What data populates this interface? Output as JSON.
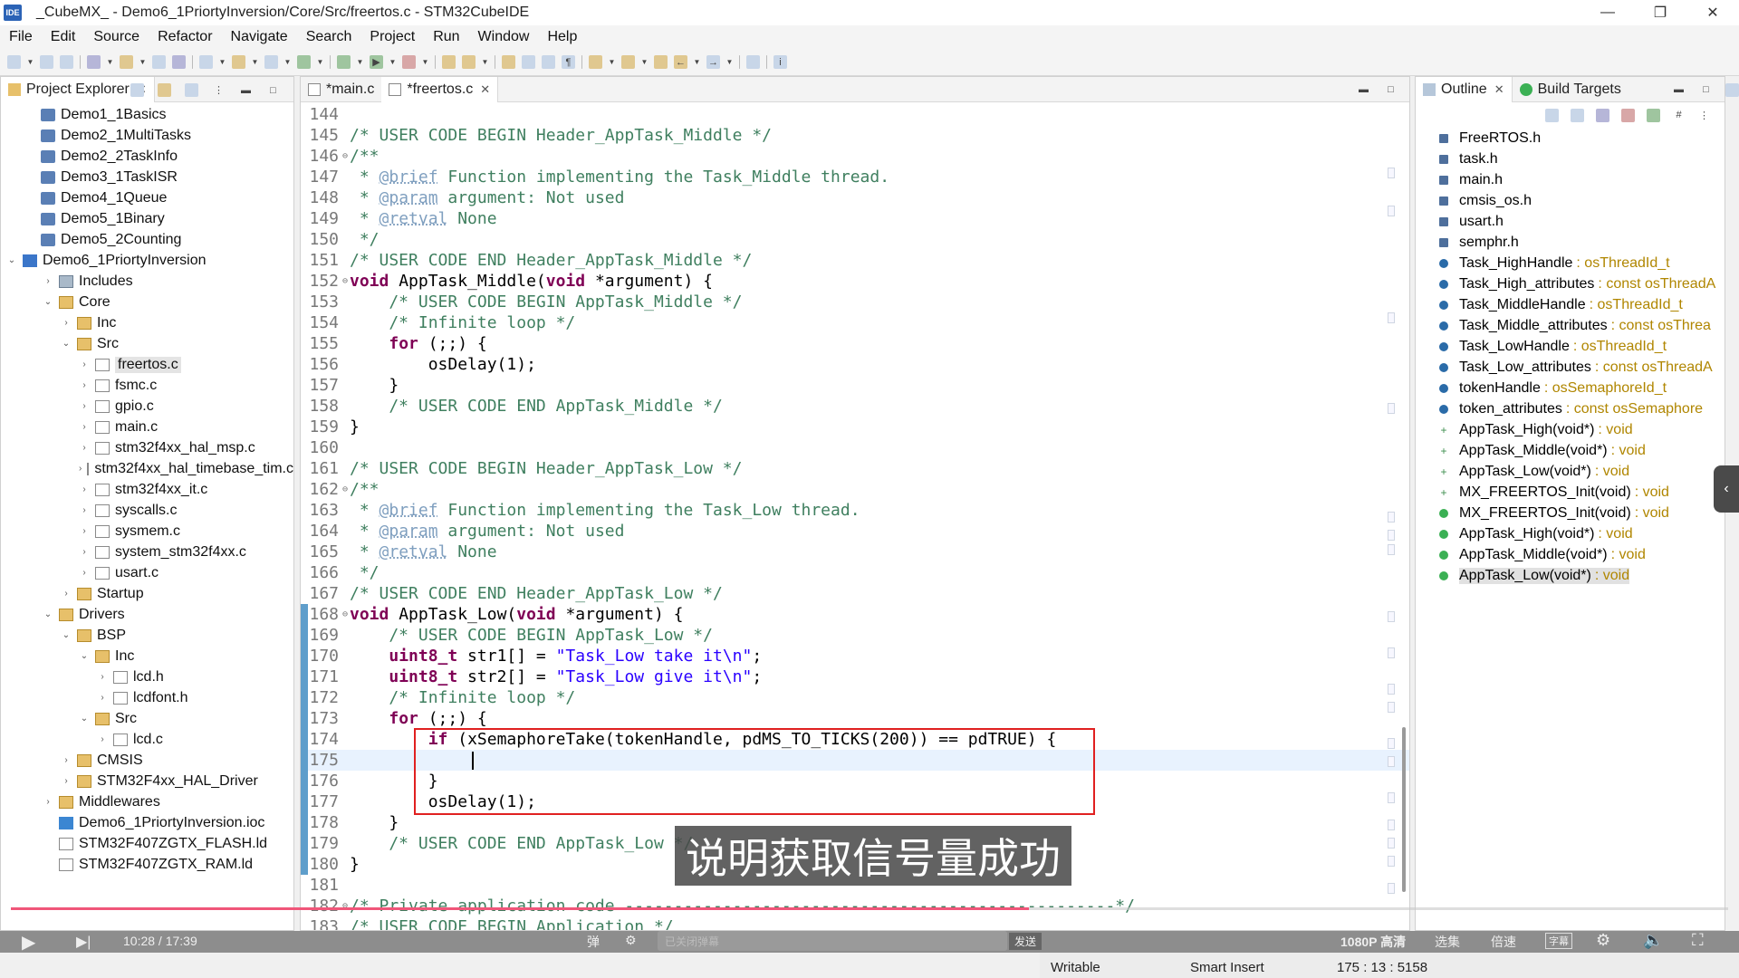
{
  "window": {
    "title": "_CubeMX_ - Demo6_1PriortyInversion/Core/Src/freertos.c - STM32CubeIDE",
    "app_icon_text": "IDE"
  },
  "menu": [
    "File",
    "Edit",
    "Source",
    "Refactor",
    "Navigate",
    "Search",
    "Project",
    "Run",
    "Window",
    "Help"
  ],
  "explorer": {
    "title": "Project Explorer",
    "items": [
      {
        "label": "Demo1_1Basics",
        "icon": "project-icon"
      },
      {
        "label": "Demo2_1MultiTasks",
        "icon": "project-icon"
      },
      {
        "label": "Demo2_2TaskInfo",
        "icon": "project-icon"
      },
      {
        "label": "Demo3_1TaskISR",
        "icon": "project-icon"
      },
      {
        "label": "Demo4_1Queue",
        "icon": "project-icon"
      },
      {
        "label": "Demo5_1Binary",
        "icon": "project-icon"
      },
      {
        "label": "Demo5_2Counting",
        "icon": "project-icon"
      },
      {
        "label": "Demo6_1PriortyInversion",
        "icon": "ide-project-icon",
        "arrow": "⌄"
      },
      {
        "label": "Includes",
        "icon": "includes-icon",
        "arrow": "›"
      },
      {
        "label": "Core",
        "icon": "folder-icon",
        "arrow": "⌄"
      },
      {
        "label": "Inc",
        "icon": "folder-icon",
        "arrow": "›"
      },
      {
        "label": "Src",
        "icon": "folder-icon",
        "arrow": "⌄"
      },
      {
        "label": "freertos.c",
        "icon": "c-file-icon",
        "arrow": "›"
      },
      {
        "label": "fsmc.c",
        "icon": "c-file-icon",
        "arrow": "›"
      },
      {
        "label": "gpio.c",
        "icon": "c-file-icon",
        "arrow": "›"
      },
      {
        "label": "main.c",
        "icon": "c-file-icon",
        "arrow": "›"
      },
      {
        "label": "stm32f4xx_hal_msp.c",
        "icon": "c-file-icon",
        "arrow": "›"
      },
      {
        "label": "stm32f4xx_hal_timebase_tim.c",
        "icon": "c-file-icon",
        "arrow": "›"
      },
      {
        "label": "stm32f4xx_it.c",
        "icon": "c-file-icon",
        "arrow": "›"
      },
      {
        "label": "syscalls.c",
        "icon": "c-file-icon",
        "arrow": "›"
      },
      {
        "label": "sysmem.c",
        "icon": "c-file-icon",
        "arrow": "›"
      },
      {
        "label": "system_stm32f4xx.c",
        "icon": "c-file-icon",
        "arrow": "›"
      },
      {
        "label": "usart.c",
        "icon": "c-file-icon",
        "arrow": "›"
      },
      {
        "label": "Startup",
        "icon": "folder-icon",
        "arrow": "›"
      },
      {
        "label": "Drivers",
        "icon": "folder-icon",
        "arrow": "⌄"
      },
      {
        "label": "BSP",
        "icon": "folder-icon",
        "arrow": "⌄"
      },
      {
        "label": "Inc",
        "icon": "folder-icon",
        "arrow": "⌄"
      },
      {
        "label": "lcd.h",
        "icon": "h-file-icon",
        "arrow": "›"
      },
      {
        "label": "lcdfont.h",
        "icon": "h-file-icon",
        "arrow": "›"
      },
      {
        "label": "Src",
        "icon": "folder-icon",
        "arrow": "⌄"
      },
      {
        "label": "lcd.c",
        "icon": "c-file-icon",
        "arrow": "›"
      },
      {
        "label": "CMSIS",
        "icon": "folder-icon",
        "arrow": "›"
      },
      {
        "label": "STM32F4xx_HAL_Driver",
        "icon": "folder-icon",
        "arrow": "›"
      },
      {
        "label": "Middlewares",
        "icon": "folder-icon",
        "arrow": "›"
      },
      {
        "label": "Demo6_1PriortyInversion.ioc",
        "icon": "mx-file-icon"
      },
      {
        "label": "STM32F407ZGTX_FLASH.ld",
        "icon": "ld-file-icon"
      },
      {
        "label": "STM32F407ZGTX_RAM.ld",
        "icon": "ld-file-icon"
      }
    ]
  },
  "editor": {
    "tabs": [
      "*main.c",
      "*freertos.c"
    ],
    "lines": [
      {
        "n": "144",
        "t": ""
      },
      {
        "n": "145",
        "t": "/* USER CODE BEGIN Header_AppTask_Middle */"
      },
      {
        "n": "146",
        "t": "/**"
      },
      {
        "n": "147",
        "t": " * @brief Function implementing the Task_Middle thread."
      },
      {
        "n": "148",
        "t": " * @param argument: Not used"
      },
      {
        "n": "149",
        "t": " * @retval None"
      },
      {
        "n": "150",
        "t": " */"
      },
      {
        "n": "151",
        "t": "/* USER CODE END Header_AppTask_Middle */"
      },
      {
        "n": "152",
        "t": "void AppTask_Middle(void *argument) {"
      },
      {
        "n": "153",
        "t": "    /* USER CODE BEGIN AppTask_Middle */"
      },
      {
        "n": "154",
        "t": "    /* Infinite loop */"
      },
      {
        "n": "155",
        "t": "    for (;;) {"
      },
      {
        "n": "156",
        "t": "        osDelay(1);"
      },
      {
        "n": "157",
        "t": "    }"
      },
      {
        "n": "158",
        "t": "    /* USER CODE END AppTask_Middle */"
      },
      {
        "n": "159",
        "t": "}"
      },
      {
        "n": "160",
        "t": ""
      },
      {
        "n": "161",
        "t": "/* USER CODE BEGIN Header_AppTask_Low */"
      },
      {
        "n": "162",
        "t": "/**"
      },
      {
        "n": "163",
        "t": " * @brief Function implementing the Task_Low thread."
      },
      {
        "n": "164",
        "t": " * @param argument: Not used"
      },
      {
        "n": "165",
        "t": " * @retval None"
      },
      {
        "n": "166",
        "t": " */"
      },
      {
        "n": "167",
        "t": "/* USER CODE END Header_AppTask_Low */"
      },
      {
        "n": "168",
        "t": "void AppTask_Low(void *argument) {"
      },
      {
        "n": "169",
        "t": "    /* USER CODE BEGIN AppTask_Low */"
      },
      {
        "n": "170",
        "t": "    uint8_t str1[] = \"Task_Low take it\\n\";"
      },
      {
        "n": "171",
        "t": "    uint8_t str2[] = \"Task_Low give it\\n\";"
      },
      {
        "n": "172",
        "t": "    /* Infinite loop */"
      },
      {
        "n": "173",
        "t": "    for (;;) {"
      },
      {
        "n": "174",
        "t": "        if (xSemaphoreTake(tokenHandle, pdMS_TO_TICKS(200)) == pdTRUE) {"
      },
      {
        "n": "175",
        "t": "            "
      },
      {
        "n": "176",
        "t": "        }"
      },
      {
        "n": "177",
        "t": "        osDelay(1);"
      },
      {
        "n": "178",
        "t": "    }"
      },
      {
        "n": "179",
        "t": "    /* USER CODE END AppTask_Low */"
      },
      {
        "n": "180",
        "t": "}"
      },
      {
        "n": "181",
        "t": ""
      },
      {
        "n": "182",
        "t": "/* Private application code --------------------------------------------------*/"
      },
      {
        "n": "183",
        "t": "/* USER CODE BEGIN Application */"
      }
    ]
  },
  "outline": {
    "tabs": [
      "Outline",
      "Build Targets"
    ],
    "items": [
      {
        "name": "FreeRTOS.h",
        "type": "",
        "kind": "include"
      },
      {
        "name": "task.h",
        "type": "",
        "kind": "include"
      },
      {
        "name": "main.h",
        "type": "",
        "kind": "include"
      },
      {
        "name": "cmsis_os.h",
        "type": "",
        "kind": "include"
      },
      {
        "name": "usart.h",
        "type": "",
        "kind": "include"
      },
      {
        "name": "semphr.h",
        "type": "",
        "kind": "include"
      },
      {
        "name": "Task_HighHandle",
        "type": ": osThreadId_t",
        "kind": "var"
      },
      {
        "name": "Task_High_attributes",
        "type": ": const osThreadA",
        "kind": "var"
      },
      {
        "name": "Task_MiddleHandle",
        "type": ": osThreadId_t",
        "kind": "var"
      },
      {
        "name": "Task_Middle_attributes",
        "type": ": const osThrea",
        "kind": "var"
      },
      {
        "name": "Task_LowHandle",
        "type": ": osThreadId_t",
        "kind": "var"
      },
      {
        "name": "Task_Low_attributes",
        "type": ": const osThreadA",
        "kind": "var"
      },
      {
        "name": "tokenHandle",
        "type": ": osSemaphoreId_t",
        "kind": "var"
      },
      {
        "name": "token_attributes",
        "type": ": const osSemaphore",
        "kind": "var"
      },
      {
        "name": "AppTask_High(void*)",
        "type": ": void",
        "kind": "decl"
      },
      {
        "name": "AppTask_Middle(void*)",
        "type": ": void",
        "kind": "decl"
      },
      {
        "name": "AppTask_Low(void*)",
        "type": ": void",
        "kind": "decl"
      },
      {
        "name": "MX_FREERTOS_Init(void)",
        "type": ": void",
        "kind": "decl"
      },
      {
        "name": "MX_FREERTOS_Init(void)",
        "type": ": void",
        "kind": "fn"
      },
      {
        "name": "AppTask_High(void*)",
        "type": ": void",
        "kind": "fn"
      },
      {
        "name": "AppTask_Middle(void*)",
        "type": ": void",
        "kind": "fn"
      },
      {
        "name": "AppTask_Low(void*)",
        "type": ": void",
        "kind": "fn"
      }
    ]
  },
  "overlay": {
    "subtitle": "说明获取信号量成功",
    "time": "10:28 / 17:39",
    "danmaku_placeholder": "已关闭弹幕",
    "send": "发送",
    "quality": "1080P 高清",
    "episodes": "选集",
    "speed": "倍速",
    "cc": "字幕",
    "progress": 0.593
  },
  "status": {
    "writable": "Writable",
    "insert": "Smart Insert",
    "position": "175 : 13 : 5158"
  }
}
